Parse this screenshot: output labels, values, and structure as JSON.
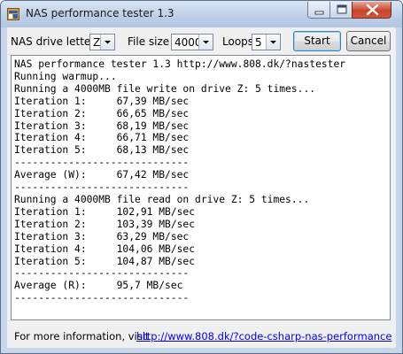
{
  "window": {
    "title": "NAS performance tester 1.3"
  },
  "toolbar": {
    "drive_label": "NAS drive letter",
    "drive_value": "Z",
    "filesize_label": "File size",
    "filesize_value": "4000",
    "loops_label": "Loops",
    "loops_value": "5",
    "start_label": "Start",
    "cancel_label": "Cancel"
  },
  "output": {
    "lines": [
      "NAS performance tester 1.3 http://www.808.dk/?nastester",
      "Running warmup...",
      "Running a 4000MB file write on drive Z: 5 times...",
      "Iteration 1:     67,39 MB/sec",
      "Iteration 2:     66,65 MB/sec",
      "Iteration 3:     68,19 MB/sec",
      "Iteration 4:     66,71 MB/sec",
      "Iteration 5:     68,13 MB/sec",
      "-----------------------------",
      "Average (W):     67,42 MB/sec",
      "-----------------------------",
      "Running a 4000MB file read on drive Z: 5 times...",
      "Iteration 1:     102,91 MB/sec",
      "Iteration 2:     103,39 MB/sec",
      "Iteration 3:     63,29 MB/sec",
      "Iteration 4:     104,06 MB/sec",
      "Iteration 5:     104,87 MB/sec",
      "-----------------------------",
      "Average (R):     95,7 MB/sec",
      "-----------------------------"
    ]
  },
  "footer": {
    "info_text": "For more information, visit",
    "link_text": "http://www.808.dk/?code-csharp-nas-performance"
  },
  "colors": {
    "link": "#0000ee",
    "title_bar": "#c7d6e9",
    "close_button": "#c7442a"
  }
}
